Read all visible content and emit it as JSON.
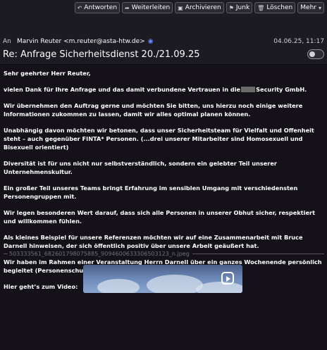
{
  "toolbar": {
    "reply": "Antworten",
    "forward": "Weiterleiten",
    "archive": "Archivieren",
    "junk": "Junk",
    "delete": "Löschen",
    "more": "Mehr"
  },
  "header": {
    "from_label": "An",
    "from": "Marvin Reuter <m.reuter@asta-htw.de>",
    "date": "04.06.25, 11:17",
    "subject": "Re: Anfrage Sicherheitsdienst 20./21.09.25"
  },
  "body": {
    "greeting": "Sehr geehrter Herr Reuter,",
    "p1_before": "vielen Dank für Ihre Anfrage und das damit verbundene Vertrauen in die",
    "p1_after": "Security GmbH.",
    "p2": "Wir übernehmen den Auftrag gerne und möchten Sie bitten, uns hierzu noch einige weitere Informationen zukommen zu lassen, damit wir alles optimal planen können.",
    "p3": "Unabhängig davon möchten wir betonen, dass unser Sicherheitsteam für Vielfalt und Offenheit steht – auch gegenüber FINTA* Personen. (...drei unserer Mitarbeiter sind Homosexuell und Bisexuell orientiert)",
    "p4": "Diversität ist für uns nicht nur selbstverständlich, sondern ein gelebter Teil unserer Unternehmenskultur.",
    "p5": "Ein großer Teil unseres Teams bringt Erfahrung im sensiblen Umgang mit verschiedensten Personengruppen mit.",
    "p6": "Wir legen besonderen Wert darauf, dass sich alle Personen in unserer Obhut sicher, respektiert und willkommen fühlen.",
    "p7": "Als kleines Beispiel für unsere Referenzen möchten wir auf eine Zusammenarbeit mit Bruce Darnell hinweisen, der sich öffentlich positiv über unsere Arbeit geäußert hat.",
    "p8": "Wir haben im Rahmen einer Veranstaltung Herrn Darnell über ein ganzes Wochenende persönlich begleitet (Personenschutz).",
    "p9": "Hier geht’s zum Video:"
  },
  "attachment": {
    "filename": "503333561_682601798075885_9094600633306503123_n.jpeg"
  }
}
